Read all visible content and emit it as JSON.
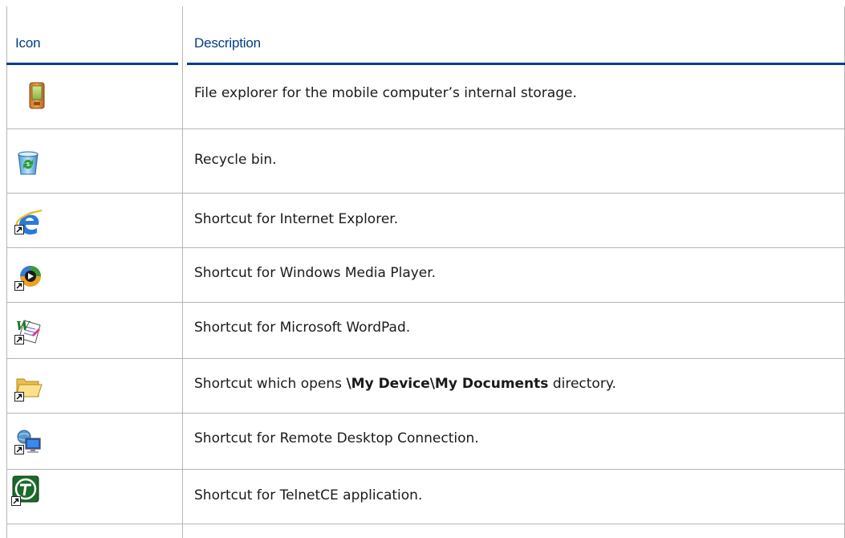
{
  "table": {
    "header": {
      "icon_label": "Icon",
      "description_label": "Description"
    },
    "rows": [
      {
        "icon": "pda-device-icon",
        "shortcut": false,
        "text": "File explorer for the mobile computer’s internal storage."
      },
      {
        "icon": "recycle-bin-icon",
        "shortcut": false,
        "text": "Recycle bin."
      },
      {
        "icon": "internet-explorer-icon",
        "shortcut": true,
        "text": "Shortcut for Internet Explorer."
      },
      {
        "icon": "windows-media-player-icon",
        "shortcut": true,
        "text": "Shortcut for Windows Media Player."
      },
      {
        "icon": "wordpad-icon",
        "shortcut": true,
        "text": "Shortcut for Microsoft WordPad."
      },
      {
        "icon": "folder-icon",
        "shortcut": true,
        "text_before": "Shortcut which opens ",
        "text_bold": "\\My Device\\My Documents",
        "text_after": " directory."
      },
      {
        "icon": "remote-desktop-icon",
        "shortcut": true,
        "text": "Shortcut for Remote Desktop Connection."
      },
      {
        "icon": "telnetce-icon",
        "shortcut": true,
        "text": "Shortcut for TelnetCE application."
      }
    ]
  },
  "colors": {
    "header_text": "#003c8c",
    "header_rule": "#003c8c",
    "grid_line": "#b5b5b5",
    "body_text": "#1a1a1a"
  }
}
